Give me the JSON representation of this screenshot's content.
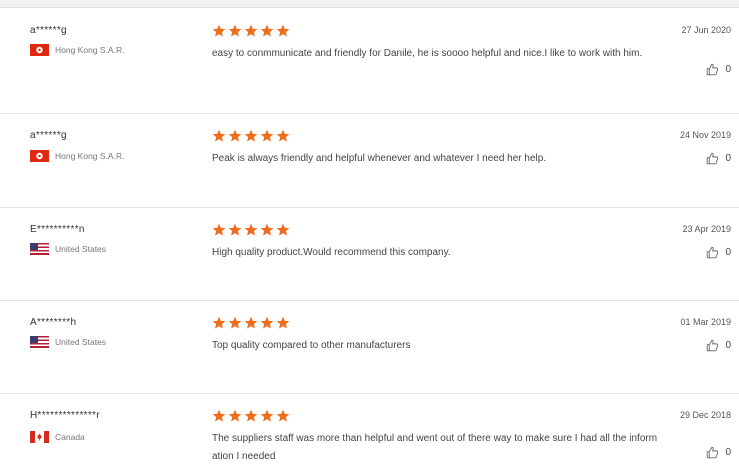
{
  "reviews": [
    {
      "user": "a******g",
      "country": "Hong Kong S.A.R.",
      "flag": "hk",
      "rating": 5,
      "comment": "easy to conmmunicate and friendly for Danile, he is soooo helpful and nice.I like to work with him.",
      "date": "27 Jun 2020",
      "likes": "0"
    },
    {
      "user": "a******g",
      "country": "Hong Kong S.A.R.",
      "flag": "hk",
      "rating": 5,
      "comment": "Peak is always friendly and helpful whenever and whatever I need her help.",
      "date": "24 Nov 2019",
      "likes": "0"
    },
    {
      "user": "E**********n",
      "country": "United States",
      "flag": "us",
      "rating": 5,
      "comment": "High quality product.Would recommend this company.",
      "date": "23 Apr 2019",
      "likes": "0"
    },
    {
      "user": "A********h",
      "country": "United States",
      "flag": "us",
      "rating": 5,
      "comment": "Top quality compared to other manufacturers",
      "date": "01 Mar 2019",
      "likes": "0"
    },
    {
      "user": "H**************r",
      "country": "Canada",
      "flag": "ca",
      "rating": 5,
      "comment": "The suppliers staff was more than helpful and went out of there way to make sure I had all the information I needed",
      "date": "29 Dec 2018",
      "likes": "0"
    }
  ],
  "colors": {
    "star": "#f06d1a",
    "divider": "#dcdcdc",
    "background": "#ffffff"
  },
  "icons": {
    "star": "star-icon",
    "like": "thumbs-up-icon"
  }
}
